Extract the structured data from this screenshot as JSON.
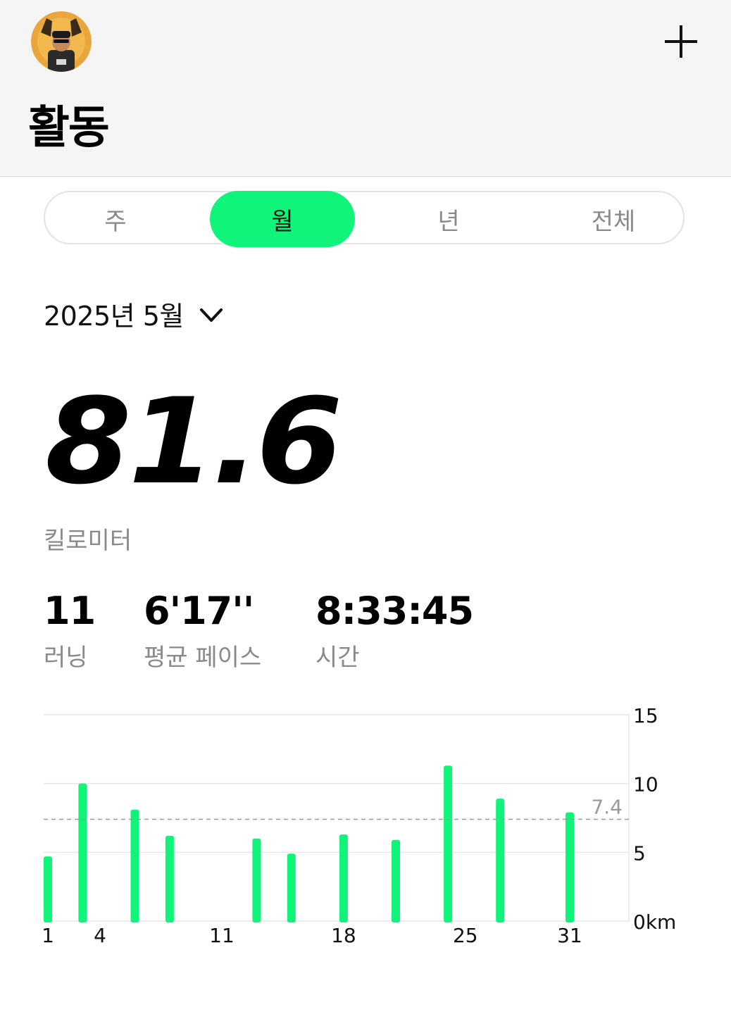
{
  "header": {
    "title": "활동",
    "add_icon": "plus-icon",
    "avatar_icon": "user-avatar"
  },
  "tabs": [
    {
      "label": "주",
      "active": false
    },
    {
      "label": "월",
      "active": true
    },
    {
      "label": "년",
      "active": false
    },
    {
      "label": "전체",
      "active": false
    }
  ],
  "period": {
    "label": "2025년 5월",
    "icon": "chevron-down-icon"
  },
  "summary": {
    "distance": "81.6",
    "distance_unit": "킬로미터"
  },
  "stats": [
    {
      "value": "11",
      "label": "러닝"
    },
    {
      "value": "6'17''",
      "label": "평균 페이스"
    },
    {
      "value": "8:33:45",
      "label": "시간"
    }
  ],
  "colors": {
    "accent": "#10f47a",
    "header_bg": "#f5f5f5",
    "muted_text": "#8a8a8a"
  },
  "chart_data": {
    "type": "bar",
    "x": [
      1,
      3,
      6,
      8,
      13,
      15,
      18,
      21,
      24,
      27,
      31
    ],
    "values": [
      4.7,
      10.0,
      8.1,
      6.2,
      6.0,
      4.9,
      6.3,
      5.9,
      11.3,
      8.9,
      7.9
    ],
    "x_ticks": [
      "1",
      "4",
      "11",
      "18",
      "25",
      "31"
    ],
    "x_tick_values": [
      1,
      4,
      11,
      18,
      25,
      31
    ],
    "xlim": [
      1,
      35
    ],
    "ylim": [
      0,
      15
    ],
    "y_ticks": [
      "15",
      "10",
      "5",
      "0km"
    ],
    "y_tick_values": [
      15,
      10,
      5,
      0
    ],
    "average": 7.4,
    "average_label": "7.4",
    "grid": true,
    "bar_color": "#10f47a"
  }
}
